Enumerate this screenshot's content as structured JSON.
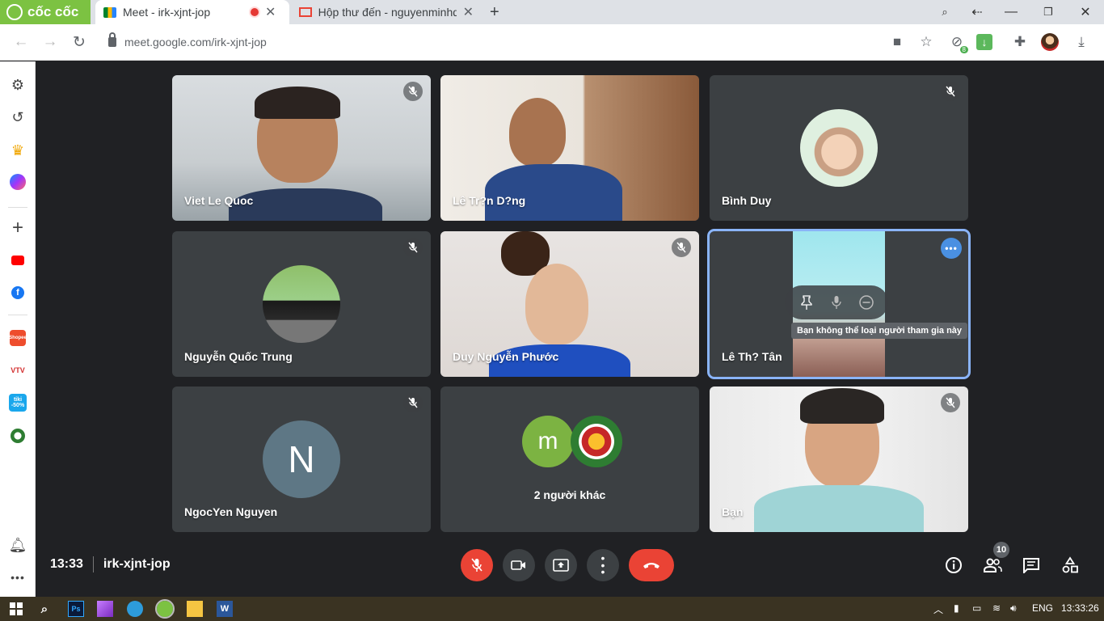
{
  "browser": {
    "brand": "cốc cốc",
    "tabs": [
      {
        "title": "Meet - irk-xjnt-jop"
      },
      {
        "title": "Hộp thư đến - nguyenminhq"
      }
    ],
    "new_tab": "+",
    "url": "meet.google.com/irk-xjnt-jop",
    "extension_badge": "8"
  },
  "sidebar": {
    "icons": [
      "settings-icon",
      "history-icon",
      "crown-icon",
      "messenger-icon",
      "add-icon",
      "youtube-icon",
      "facebook-icon",
      "shopee-icon",
      "vtv-icon",
      "tiki-icon",
      "football-icon",
      "bell-icon",
      "more-icon"
    ],
    "shopee_label": "Shopee",
    "vtv_label": "VTV",
    "tiki_label": "tiki",
    "tiki_sub": "-50%"
  },
  "meeting": {
    "participants": [
      {
        "name": "Viet Le Quoc",
        "muted": true
      },
      {
        "name": "Lê Tr?n D?ng",
        "muted": false
      },
      {
        "name": "Bình Duy",
        "muted": true
      },
      {
        "name": "Nguyễn Quốc Trung",
        "muted": true
      },
      {
        "name": "Duy Nguyễn Phước",
        "muted": true
      },
      {
        "name": "Lê Th? Tân",
        "muted": false
      },
      {
        "name": "NgocYen Nguyen",
        "muted": true
      },
      {
        "name": "2 người khác",
        "muted": false
      },
      {
        "name": "Bạn",
        "muted": true
      }
    ],
    "ngocyen_initial": "N",
    "others_initial": "m",
    "tooltip": "Bạn không thể loại người tham gia này",
    "time": "13:33",
    "code": "irk-xjnt-jop",
    "participant_count": "10"
  },
  "taskbar": {
    "lang": "ENG",
    "clock": "13:33:26"
  },
  "colors": {
    "brand_green": "#7cc242",
    "hangup_red": "#ea4335",
    "tile_bg": "#3c4043",
    "stage_bg": "#202124",
    "focus_outline": "#8ab4f8"
  }
}
